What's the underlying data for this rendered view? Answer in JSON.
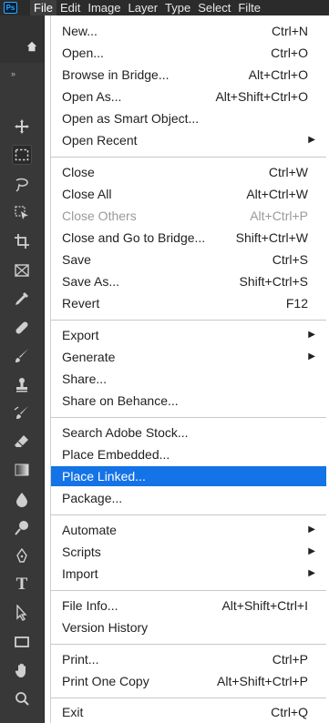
{
  "menubar": {
    "logo": "Ps",
    "items": [
      "File",
      "Edit",
      "Image",
      "Layer",
      "Type",
      "Select",
      "Filte"
    ]
  },
  "colors": {
    "highlight": "#1473e6",
    "toolbar_bg": "#383838",
    "menubar_bg": "#2b2b2b"
  },
  "toolbar": {
    "collapse_icon": "double-chevron-icon",
    "tools": [
      "move-icon",
      "marquee-icon",
      "lasso-icon",
      "object-select-icon",
      "crop-icon",
      "frame-icon",
      "eyedropper-icon",
      "healing-icon",
      "brush-icon",
      "stamp-icon",
      "history-brush-icon",
      "eraser-icon",
      "gradient-icon",
      "blur-icon",
      "dodge-icon",
      "pen-icon",
      "type-icon",
      "path-select-icon",
      "rectangle-icon",
      "hand-icon",
      "zoom-icon"
    ]
  },
  "menu": {
    "items": [
      {
        "label": "New...",
        "shortcut": "Ctrl+N"
      },
      {
        "label": "Open...",
        "shortcut": "Ctrl+O"
      },
      {
        "label": "Browse in Bridge...",
        "shortcut": "Alt+Ctrl+O"
      },
      {
        "label": "Open As...",
        "shortcut": "Alt+Shift+Ctrl+O"
      },
      {
        "label": "Open as Smart Object...",
        "shortcut": ""
      },
      {
        "label": "Open Recent",
        "shortcut": "",
        "submenu": true
      },
      {
        "label": "Close",
        "shortcut": "Ctrl+W"
      },
      {
        "label": "Close All",
        "shortcut": "Alt+Ctrl+W"
      },
      {
        "label": "Close Others",
        "shortcut": "Alt+Ctrl+P",
        "disabled": true
      },
      {
        "label": "Close and Go to Bridge...",
        "shortcut": "Shift+Ctrl+W"
      },
      {
        "label": "Save",
        "shortcut": "Ctrl+S"
      },
      {
        "label": "Save As...",
        "shortcut": "Shift+Ctrl+S"
      },
      {
        "label": "Revert",
        "shortcut": "F12"
      },
      {
        "label": "Export",
        "shortcut": "",
        "submenu": true
      },
      {
        "label": "Generate",
        "shortcut": "",
        "submenu": true
      },
      {
        "label": "Share...",
        "shortcut": ""
      },
      {
        "label": "Share on Behance...",
        "shortcut": ""
      },
      {
        "label": "Search Adobe Stock...",
        "shortcut": ""
      },
      {
        "label": "Place Embedded...",
        "shortcut": ""
      },
      {
        "label": "Place Linked...",
        "shortcut": "",
        "highlighted": true
      },
      {
        "label": "Package...",
        "shortcut": ""
      },
      {
        "label": "Automate",
        "shortcut": "",
        "submenu": true
      },
      {
        "label": "Scripts",
        "shortcut": "",
        "submenu": true
      },
      {
        "label": "Import",
        "shortcut": "",
        "submenu": true
      },
      {
        "label": "File Info...",
        "shortcut": "Alt+Shift+Ctrl+I"
      },
      {
        "label": "Version History",
        "shortcut": ""
      },
      {
        "label": "Print...",
        "shortcut": "Ctrl+P"
      },
      {
        "label": "Print One Copy",
        "shortcut": "Alt+Shift+Ctrl+P"
      },
      {
        "label": "Exit",
        "shortcut": "Ctrl+Q"
      }
    ]
  }
}
